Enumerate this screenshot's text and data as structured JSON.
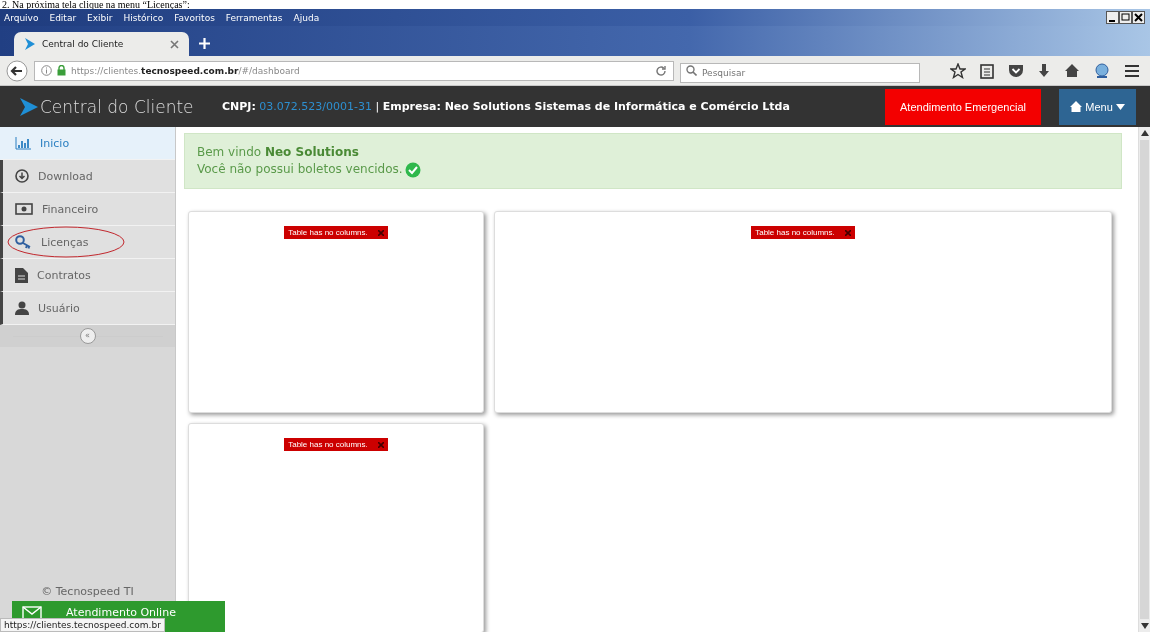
{
  "caption": "2. Na próxima tela clique na menu “Licenças”:",
  "menu_bar": [
    "Arquivo",
    "Editar",
    "Exibir",
    "Histórico",
    "Favoritos",
    "Ferramentas",
    "Ajuda"
  ],
  "tabs": [
    {
      "title": "Central do Cliente",
      "selected": true
    }
  ],
  "address_bar": {
    "url": "https://clientes.**tecnospeed.com.br**/#/dashboard"
  },
  "search": {
    "placeholder": "Pesquisar"
  },
  "header": {
    "brand": "Central do Cliente",
    "cnpj_label": "CNPJ:",
    "cnpj": "03.072.523/0001-31",
    "company": "| **Empresa: Neo Solutions Sistemas de Informática e Comércio Ltda**",
    "emergency_button": "Atendimento Emergencial",
    "menu_button": "Menu"
  },
  "sidebar": {
    "items": [
      {
        "label": "Inicio",
        "selected": true,
        "circled": false
      },
      {
        "label": "Download",
        "selected": false,
        "circled": false
      },
      {
        "label": "Financeiro",
        "selected": false,
        "circled": false
      },
      {
        "label": "Licenças",
        "selected": false,
        "circled": true
      },
      {
        "label": "Contratos",
        "selected": false,
        "circled": false
      },
      {
        "label": "Usuário",
        "selected": false,
        "circled": false
      }
    ],
    "collapse": "«",
    "copyright": "© Tecnospeed TI"
  },
  "alert": {
    "greeting": "Bem vindo **Neo Solutions**",
    "message": "Você não possui boletos vencidos."
  },
  "cards": [
    {
      "error": "Table has no columns."
    },
    {
      "error": "Table has no columns."
    },
    {
      "error": "Table has no columns."
    }
  ],
  "chat_button": "Atendimento Online",
  "status_url": "https://clientes.tecnospeed.com.br"
}
